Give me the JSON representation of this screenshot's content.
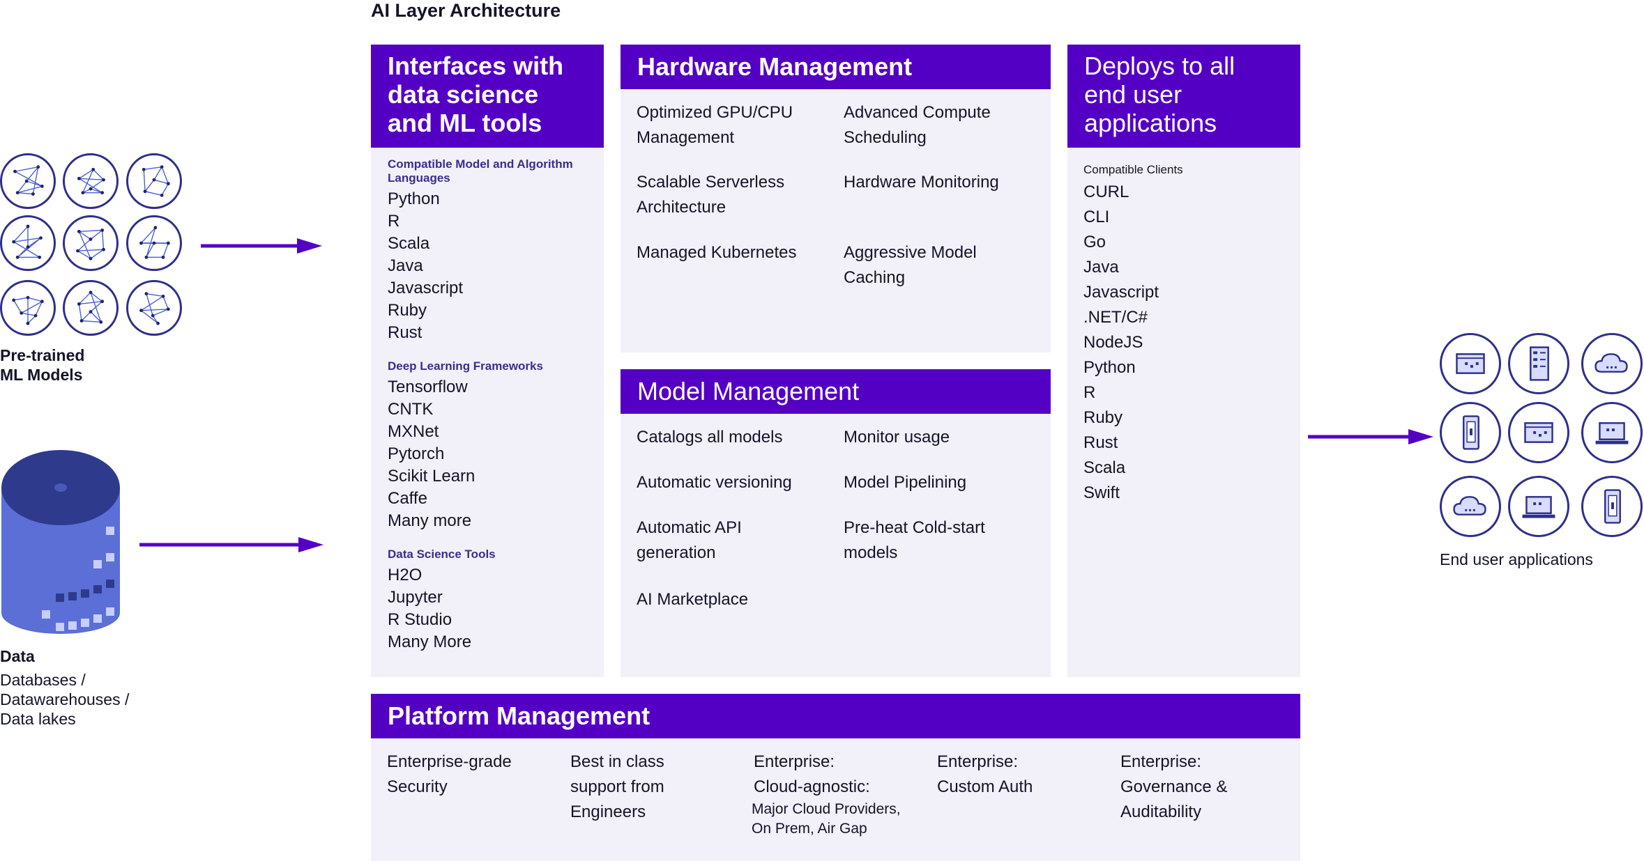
{
  "title": "AI Layer Architecture",
  "left": {
    "models_label": [
      "Pre-trained",
      "ML Models"
    ],
    "data_label": "Data",
    "data_sub": [
      "Databases /",
      "Datawarehouses /",
      "Data lakes"
    ]
  },
  "interfaces": {
    "heading": [
      "Interfaces with",
      "data science",
      "and ML tools"
    ],
    "sections": [
      {
        "label": [
          "Compatible Model and Algorithm",
          "Languages"
        ],
        "items": [
          "Python",
          "R",
          "Scala",
          "Java",
          "Javascript",
          "Ruby",
          "Rust"
        ]
      },
      {
        "label": [
          "Deep Learning Frameworks"
        ],
        "items": [
          "Tensorflow",
          "CNTK",
          "MXNet",
          "Pytorch",
          "Scikit Learn",
          "Caffe",
          "Many more"
        ]
      },
      {
        "label": [
          "Data Science Tools"
        ],
        "items": [
          "H2O",
          "Jupyter",
          "R Studio",
          "Many More"
        ]
      }
    ]
  },
  "hardware": {
    "heading": "Hardware Management",
    "cells": [
      [
        "Optimized GPU/CPU",
        "Management"
      ],
      [
        "Advanced Compute",
        "Scheduling"
      ],
      [
        "Scalable Serverless",
        "Architecture"
      ],
      [
        "Hardware Monitoring"
      ],
      [
        "Managed Kubernetes"
      ],
      [
        "Aggressive Model",
        "Caching"
      ]
    ]
  },
  "model": {
    "heading": "Model Management",
    "cells": [
      [
        "Catalogs all models"
      ],
      [
        "Monitor usage"
      ],
      [
        "Automatic versioning"
      ],
      [
        "Model Pipelining"
      ],
      [
        "Automatic API",
        "generation"
      ],
      [
        "Pre-heat Cold-start",
        "models"
      ],
      [
        "AI Marketplace"
      ]
    ]
  },
  "deploys": {
    "heading": [
      "Deploys to all",
      "end user",
      "applications"
    ],
    "clients_label": "Compatible Clients",
    "clients": [
      "CURL",
      "CLI",
      "Go",
      "Java",
      "Javascript",
      ".NET/C#",
      "NodeJS",
      "Python",
      "R",
      "Ruby",
      "Rust",
      "Scala",
      "Swift"
    ]
  },
  "platform": {
    "heading": "Platform Management",
    "cols": [
      {
        "lines": [
          "Enterprise-grade",
          "Security"
        ],
        "note": []
      },
      {
        "lines": [
          "Best in class",
          "support from",
          "Engineers"
        ],
        "note": []
      },
      {
        "lines": [
          "Enterprise:",
          "Cloud-agnostic:"
        ],
        "note": [
          "Major Cloud Providers,",
          "On Prem, Air Gap"
        ]
      },
      {
        "lines": [
          "Enterprise:",
          "Custom Auth"
        ],
        "note": []
      },
      {
        "lines": [
          "Enterprise:",
          "Governance &",
          "Auditability"
        ],
        "note": []
      }
    ]
  },
  "right": {
    "label": "End user applications",
    "icons": [
      "browser-window-icon",
      "server-rack-icon",
      "cloud-icon",
      "mobile-phone-icon",
      "browser-window-icon",
      "laptop-icon",
      "cloud-icon",
      "laptop-icon",
      "mobile-phone-icon"
    ]
  },
  "colors": {
    "accent": "#5400c4",
    "panel": "#f2f0f9",
    "navy": "#2e2f8a",
    "cylinder": "#5b6fd6"
  }
}
